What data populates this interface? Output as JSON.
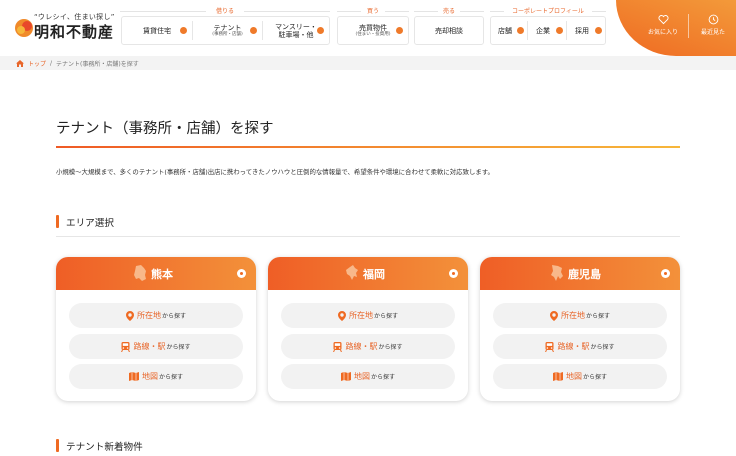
{
  "header": {
    "logo_tagline": "“ウレシイ、住まい探し”",
    "logo_name": "明和不動産",
    "categories": {
      "borrow": "借りる",
      "buy": "買う",
      "sell": "売る",
      "corporate": "コーポレートプロフィール"
    },
    "nav": {
      "chintai": "賃貸住宅",
      "tenant": "テナント",
      "tenant_sub": "(事務所・店舗)",
      "monthly": "マンスリー・",
      "monthly_2": "駐車場・他",
      "baibai": "売買物件",
      "baibai_sub": "(住まい・投資用)",
      "baikyaku": "売却相談",
      "tenpo": "店舗",
      "kigyo": "企業",
      "saiyo": "採用"
    },
    "favorites_label": "お気に入り",
    "recent_label": "最近見た"
  },
  "breadcrumb": {
    "home": "トップ",
    "separator": "/",
    "current": "テナント(事務所・店舗)を探す"
  },
  "page": {
    "title": "テナント（事務所・店舗）を探す",
    "intro": "小規模〜大規模まで、多くのテナント(事務所・店舗)出店に携わってきたノウハウと圧倒的な情報量で、希望条件や環境に合わせて柔軟に対応致します。"
  },
  "area_section": {
    "heading": "エリア選択",
    "cards": [
      {
        "name": "熊本",
        "btn_location": "所在地",
        "btn_line": "路線・駅",
        "btn_map": "地図",
        "suffix": "から探す"
      },
      {
        "name": "福岡",
        "btn_location": "所在地",
        "btn_line": "路線・駅",
        "btn_map": "地図",
        "suffix": "から探す"
      },
      {
        "name": "鹿児島",
        "btn_location": "所在地",
        "btn_line": "路線・駅",
        "btn_map": "地図",
        "suffix": "から探す"
      }
    ]
  },
  "new_section": {
    "heading": "テナント新着物件"
  },
  "colors": {
    "accent": "#ef6a22",
    "accent_light": "#f3913a",
    "button_bg": "#f2f2f2"
  }
}
